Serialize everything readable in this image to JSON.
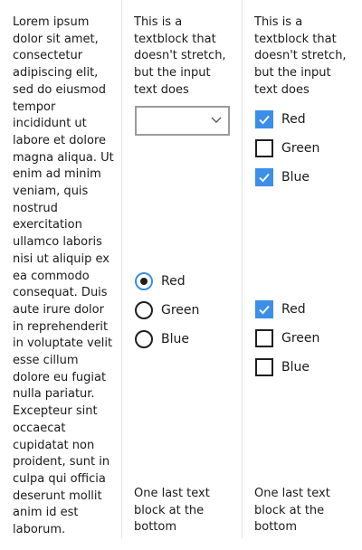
{
  "col1": {
    "lorem": "Lorem ipsum dolor sit amet, consectetur adipiscing elit, sed do eiusmod tempor incididunt ut labore et dolore magna aliqua. Ut enim ad minim veniam, quis nostrud exercitation ullamco laboris nisi ut aliquip ex ea commodo consequat. Duis aute irure dolor in reprehenderit in voluptate velit esse cillum dolore eu fugiat nulla pariatur. Excepteur sint occaecat cupidatat non proident, sunt in culpa qui officia deserunt mollit anim id est laborum."
  },
  "col2": {
    "textblock": "This is a textblock that doesn't stretch, but the input text does",
    "combo_value": "",
    "radios": [
      {
        "label": "Red",
        "checked": true
      },
      {
        "label": "Green",
        "checked": false
      },
      {
        "label": "Blue",
        "checked": false
      }
    ],
    "bottom_text": "One last text block at the bottom"
  },
  "col3": {
    "textblock": "This is a textblock that doesn't stretch, but the input text does",
    "checks_top": [
      {
        "label": "Red",
        "checked": true
      },
      {
        "label": "Green",
        "checked": false
      },
      {
        "label": "Blue",
        "checked": true
      }
    ],
    "checks_bottom": [
      {
        "label": "Red",
        "checked": true
      },
      {
        "label": "Green",
        "checked": false
      },
      {
        "label": "Blue",
        "checked": false
      }
    ],
    "bottom_text": "One last text block at the bottom"
  },
  "colors": {
    "accent": "#3c8fe6",
    "border": "#1f1f1f",
    "divider": "#e6e6e6"
  }
}
